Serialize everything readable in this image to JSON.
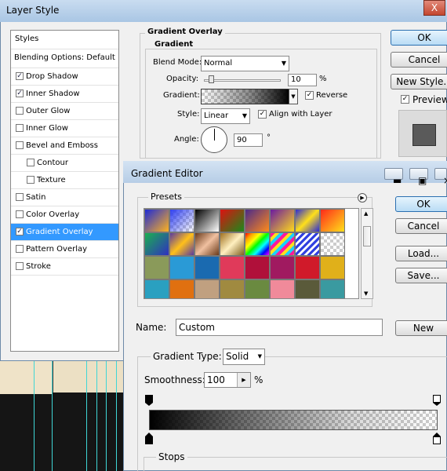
{
  "layer_style": {
    "title": "Layer Style",
    "close_label": "X",
    "styles_header": "Styles",
    "blending_options": "Blending Options: Default",
    "style_items": [
      {
        "label": "Drop Shadow",
        "checked": true,
        "selected": false,
        "indent": false
      },
      {
        "label": "Inner Shadow",
        "checked": true,
        "selected": false,
        "indent": false
      },
      {
        "label": "Outer Glow",
        "checked": false,
        "selected": false,
        "indent": false
      },
      {
        "label": "Inner Glow",
        "checked": false,
        "selected": false,
        "indent": false
      },
      {
        "label": "Bevel and Emboss",
        "checked": false,
        "selected": false,
        "indent": false
      },
      {
        "label": "Contour",
        "checked": false,
        "selected": false,
        "indent": true
      },
      {
        "label": "Texture",
        "checked": false,
        "selected": false,
        "indent": true
      },
      {
        "label": "Satin",
        "checked": false,
        "selected": false,
        "indent": false
      },
      {
        "label": "Color Overlay",
        "checked": false,
        "selected": false,
        "indent": false
      },
      {
        "label": "Gradient Overlay",
        "checked": true,
        "selected": true,
        "indent": false
      },
      {
        "label": "Pattern Overlay",
        "checked": false,
        "selected": false,
        "indent": false
      },
      {
        "label": "Stroke",
        "checked": false,
        "selected": false,
        "indent": false
      }
    ],
    "gradient_overlay": {
      "section_title": "Gradient Overlay",
      "group_title": "Gradient",
      "blend_mode_label": "Blend Mode:",
      "blend_mode_value": "Normal",
      "opacity_label": "Opacity:",
      "opacity_value": "10",
      "opacity_unit": "%",
      "gradient_label": "Gradient:",
      "reverse_label": "Reverse",
      "reverse_checked": true,
      "style_label": "Style:",
      "style_value": "Linear",
      "align_label": "Align with Layer",
      "align_checked": true,
      "angle_label": "Angle:",
      "angle_value": "90",
      "angle_unit": "°"
    },
    "buttons": {
      "ok": "OK",
      "cancel": "Cancel",
      "new_style": "New Style...",
      "preview": "Preview",
      "preview_checked": true
    }
  },
  "gradient_editor": {
    "title": "Gradient Editor",
    "presets_label": "Presets",
    "buttons": {
      "ok": "OK",
      "cancel": "Cancel",
      "load": "Load...",
      "save": "Save...",
      "new": "New"
    },
    "name_label": "Name:",
    "name_value": "Custom",
    "gradient_type_label": "Gradient Type:",
    "gradient_type_value": "Solid",
    "smoothness_label": "Smoothness:",
    "smoothness_value": "100",
    "smoothness_unit": "%",
    "stops_label": "Stops"
  },
  "colors": {
    "selection": "#3399ff",
    "default_button": "#2a6fb0",
    "guide_lines": "#3fd6d6"
  }
}
